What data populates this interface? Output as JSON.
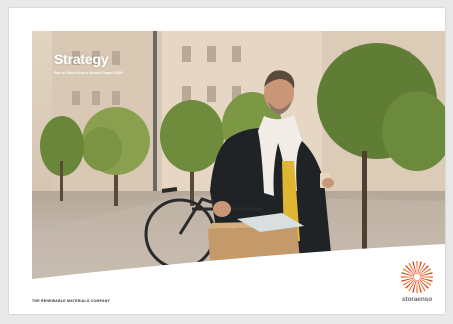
{
  "cover": {
    "title": "Strategy",
    "subtitle": "Part of Stora Enso's Annual Report 2020"
  },
  "footer": {
    "tagline": "THE RENEWABLE MATERIALS COMPANY"
  },
  "brand": {
    "logo_text": "storaenso",
    "logo_primary_color": "#f47a20",
    "logo_secondary_color": "#e4322b"
  }
}
